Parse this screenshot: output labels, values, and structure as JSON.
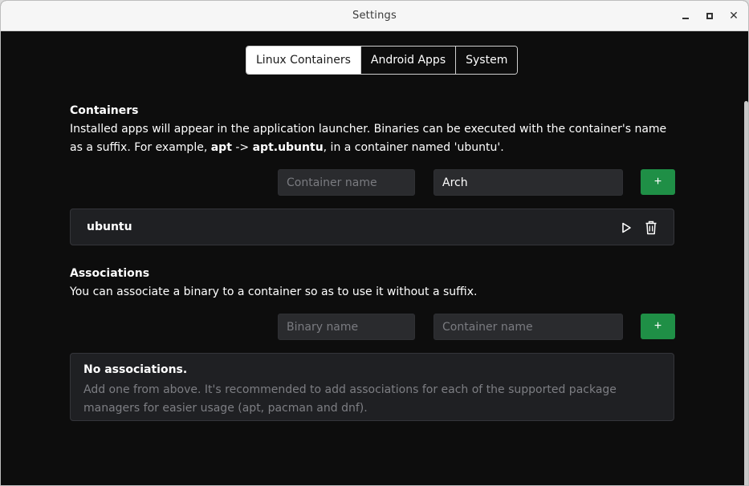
{
  "window": {
    "title": "Settings"
  },
  "tabs": [
    {
      "label": "Linux Containers",
      "active": true
    },
    {
      "label": "Android Apps",
      "active": false
    },
    {
      "label": "System",
      "active": false
    }
  ],
  "containers": {
    "title": "Containers",
    "desc_part1": "Installed apps will appear in the application launcher. Binaries can be executed with the container's name as a suffix. For example, ",
    "desc_bold1": "apt",
    "desc_arrow": " -> ",
    "desc_bold2": "apt.ubuntu",
    "desc_part2": ", in a container named 'ubuntu'.",
    "name_placeholder": "Container name",
    "distro_value": "Arch",
    "add_label": "+",
    "items": [
      {
        "name": "ubuntu"
      }
    ]
  },
  "associations": {
    "title": "Associations",
    "desc": "You can associate a binary to a container so as to use it without a suffix.",
    "binary_placeholder": "Binary name",
    "container_placeholder": "Container name",
    "add_label": "+",
    "empty_title": "No associations.",
    "empty_desc": "Add one from above. It's recommended to add associations for each of the supported package managers for easier usage (apt, pacman and dnf)."
  },
  "icons": {
    "play": "play-icon",
    "trash": "trash-icon",
    "minimize": "minimize-icon",
    "maximize": "maximize-icon",
    "close": "close-icon"
  },
  "colors": {
    "accent_green": "#1f8f46",
    "background": "#0d0d0d",
    "card": "#1f2023"
  }
}
